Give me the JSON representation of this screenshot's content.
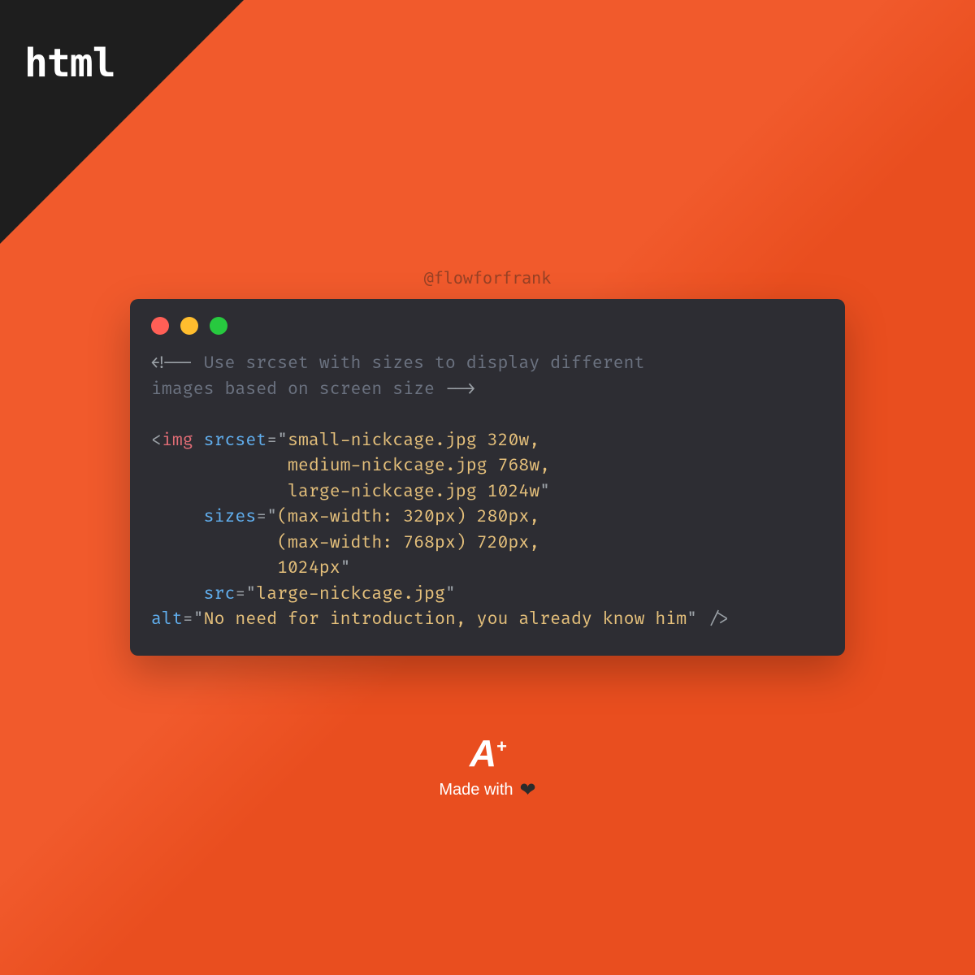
{
  "corner_label": "html",
  "watermark": "@flowforfrank",
  "code": {
    "comment": "<!-- Use srcset with sizes to display different\nimages based on screen size -->",
    "tag": "img",
    "attrs": {
      "srcset_name": "srcset",
      "srcset_value": "small-nickcage.jpg 320w,\n             medium-nickcage.jpg 768w,\n             large-nickcage.jpg 1024w",
      "sizes_name": "sizes",
      "sizes_value": "(max-width: 320px) 280px,\n            (max-width: 768px) 720px,\n            1024px",
      "src_name": "src",
      "src_value": "large-nickcage.jpg",
      "alt_name": "alt",
      "alt_value": "No need for introduction, you already know him"
    }
  },
  "footer": {
    "logo_letter": "A",
    "logo_plus": "+",
    "made": "Made with"
  }
}
